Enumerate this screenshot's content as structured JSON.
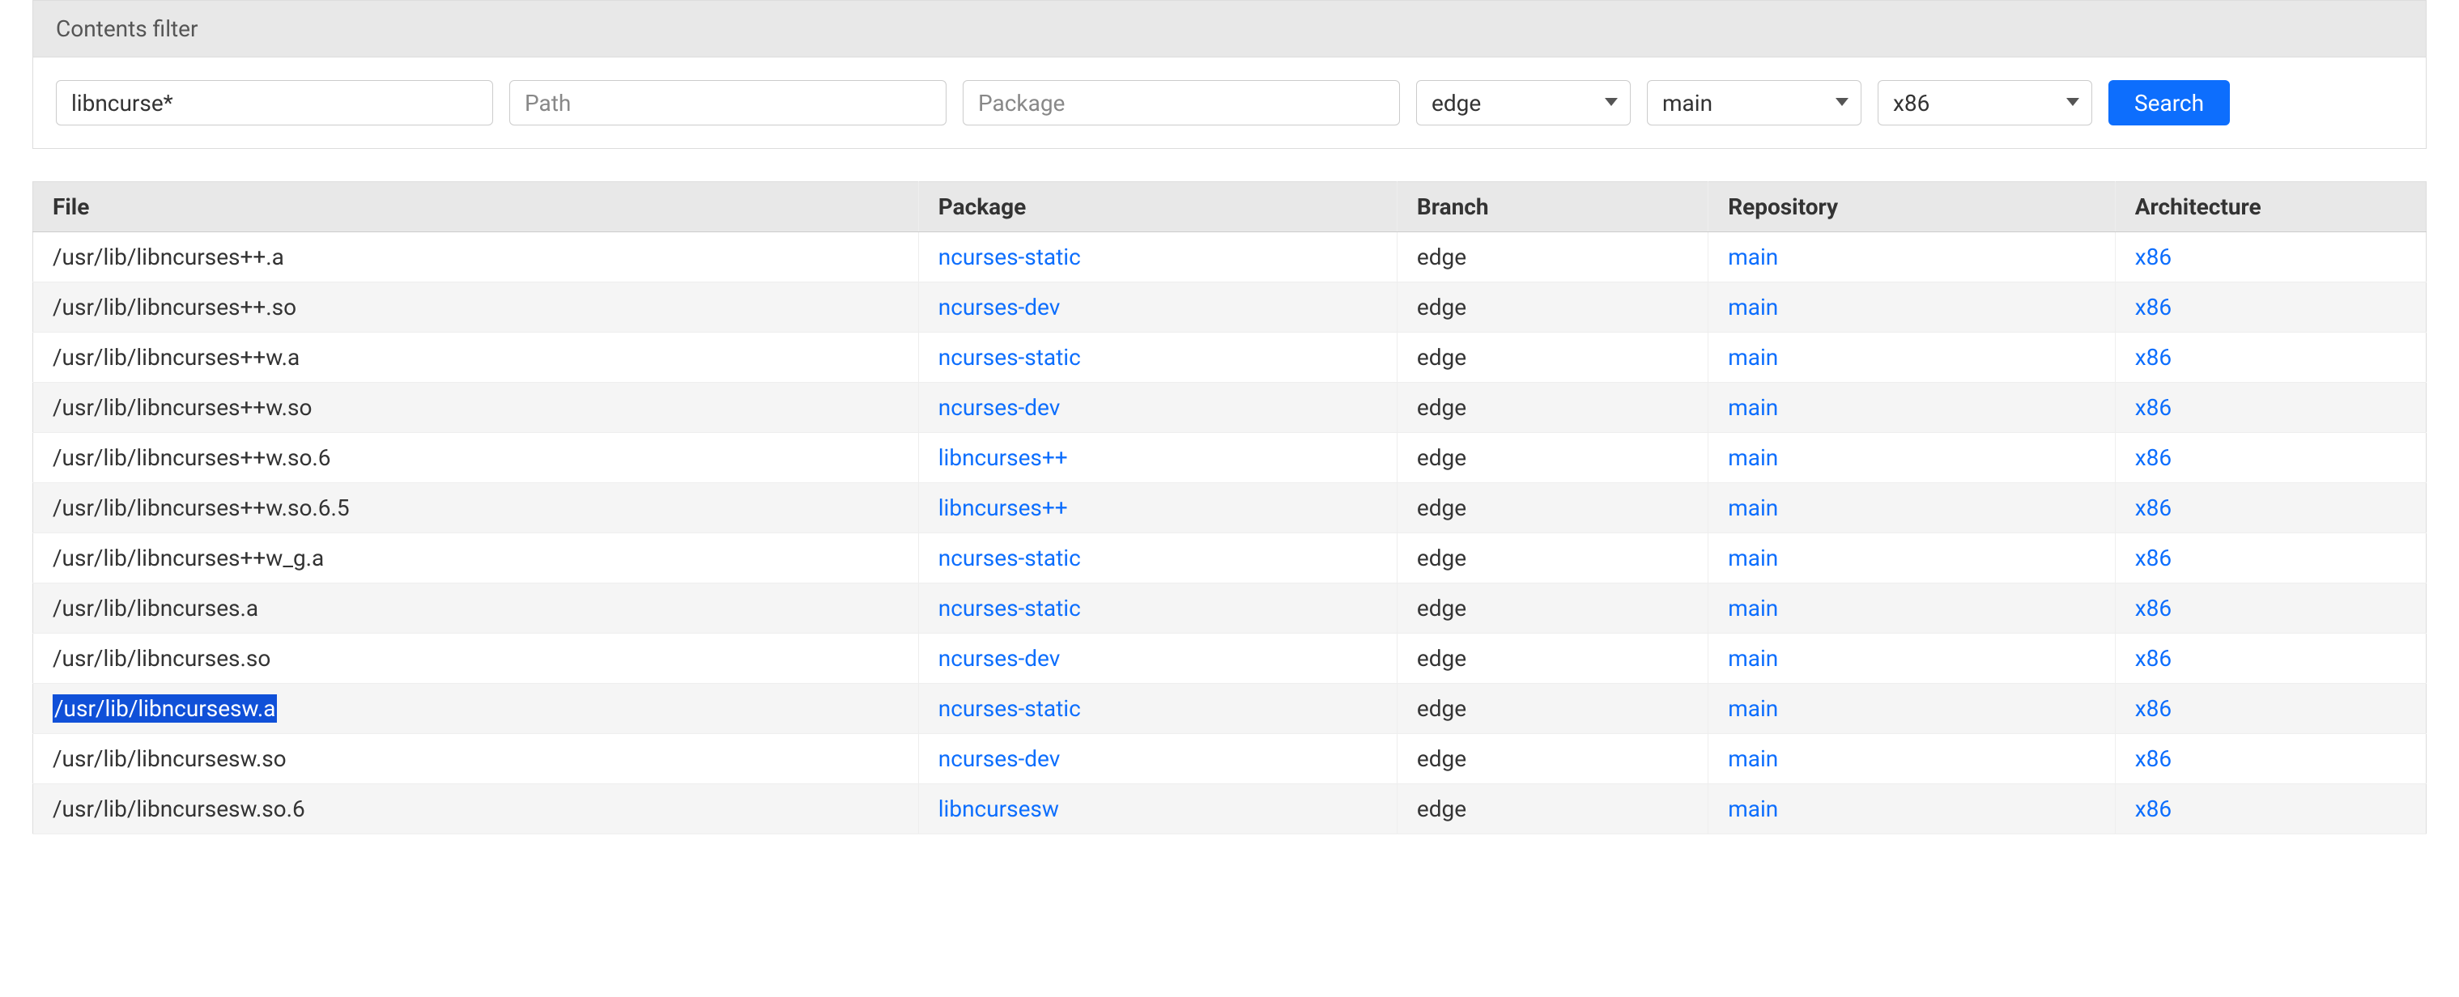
{
  "filter": {
    "title": "Contents filter",
    "file_value": "libncurse*",
    "path_placeholder": "Path",
    "package_placeholder": "Package",
    "branch_value": "edge",
    "repo_value": "main",
    "arch_value": "x86",
    "search_label": "Search"
  },
  "columns": {
    "file": "File",
    "package": "Package",
    "branch": "Branch",
    "repository": "Repository",
    "architecture": "Architecture"
  },
  "rows": [
    {
      "file": "/usr/lib/libncurses++.a",
      "package": "ncurses-static",
      "branch": "edge",
      "repo": "main",
      "arch": "x86",
      "highlighted": false
    },
    {
      "file": "/usr/lib/libncurses++.so",
      "package": "ncurses-dev",
      "branch": "edge",
      "repo": "main",
      "arch": "x86",
      "highlighted": false
    },
    {
      "file": "/usr/lib/libncurses++w.a",
      "package": "ncurses-static",
      "branch": "edge",
      "repo": "main",
      "arch": "x86",
      "highlighted": false
    },
    {
      "file": "/usr/lib/libncurses++w.so",
      "package": "ncurses-dev",
      "branch": "edge",
      "repo": "main",
      "arch": "x86",
      "highlighted": false
    },
    {
      "file": "/usr/lib/libncurses++w.so.6",
      "package": "libncurses++",
      "branch": "edge",
      "repo": "main",
      "arch": "x86",
      "highlighted": false
    },
    {
      "file": "/usr/lib/libncurses++w.so.6.5",
      "package": "libncurses++",
      "branch": "edge",
      "repo": "main",
      "arch": "x86",
      "highlighted": false
    },
    {
      "file": "/usr/lib/libncurses++w_g.a",
      "package": "ncurses-static",
      "branch": "edge",
      "repo": "main",
      "arch": "x86",
      "highlighted": false
    },
    {
      "file": "/usr/lib/libncurses.a",
      "package": "ncurses-static",
      "branch": "edge",
      "repo": "main",
      "arch": "x86",
      "highlighted": false
    },
    {
      "file": "/usr/lib/libncurses.so",
      "package": "ncurses-dev",
      "branch": "edge",
      "repo": "main",
      "arch": "x86",
      "highlighted": false
    },
    {
      "file": "/usr/lib/libncursesw.a",
      "package": "ncurses-static",
      "branch": "edge",
      "repo": "main",
      "arch": "x86",
      "highlighted": true
    },
    {
      "file": "/usr/lib/libncursesw.so",
      "package": "ncurses-dev",
      "branch": "edge",
      "repo": "main",
      "arch": "x86",
      "highlighted": false
    },
    {
      "file": "/usr/lib/libncursesw.so.6",
      "package": "libncursesw",
      "branch": "edge",
      "repo": "main",
      "arch": "x86",
      "highlighted": false
    }
  ]
}
